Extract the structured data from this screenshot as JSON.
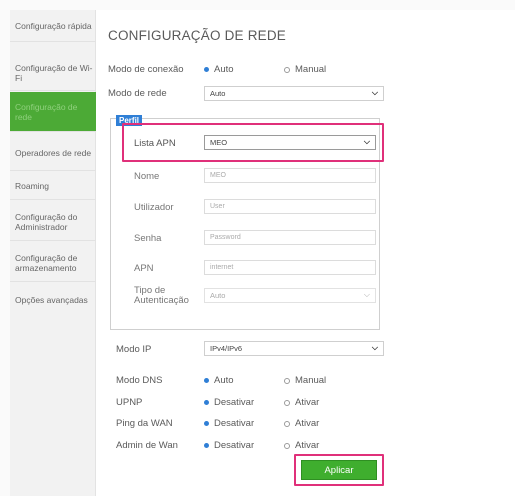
{
  "sidebar": {
    "items": [
      {
        "label": "Configuração rápida"
      },
      {
        "label": "Configuração de Wi-Fi"
      },
      {
        "label": "Configuração de rede"
      },
      {
        "label": "Operadores de rede"
      },
      {
        "label": "Roaming"
      },
      {
        "label": "Configuração do Administrador"
      },
      {
        "label": "Configuração de armazenamento"
      },
      {
        "label": "Opções avançadas"
      }
    ]
  },
  "page": {
    "title": "CONFIGURAÇÃO DE REDE"
  },
  "connection_mode": {
    "label": "Modo de conexão",
    "option_auto": "Auto",
    "option_manual": "Manual",
    "selected": "Auto"
  },
  "network_mode": {
    "label": "Modo de rede",
    "value": "Auto"
  },
  "profile": {
    "tag": "Perfil",
    "apn_list": {
      "label": "Lista APN",
      "value": "MEO"
    },
    "name": {
      "label": "Nome",
      "value": "MEO"
    },
    "user": {
      "label": "Utilizador",
      "placeholder": "User"
    },
    "password": {
      "label": "Senha",
      "placeholder": "Password"
    },
    "apn": {
      "label": "APN",
      "value": "internet"
    },
    "auth_type": {
      "label": "Tipo de Autenticação",
      "value": "Auto"
    }
  },
  "ip_mode": {
    "label": "Modo IP",
    "value": "IPv4/IPv6"
  },
  "dns_mode": {
    "label": "Modo DNS",
    "option_auto": "Auto",
    "option_manual": "Manual",
    "selected": "Auto"
  },
  "upnp": {
    "label": "UPNP",
    "option_off": "Desativar",
    "option_on": "Ativar",
    "selected": "Desativar"
  },
  "wan_ping": {
    "label": "Ping da WAN",
    "option_off": "Desativar",
    "option_on": "Ativar",
    "selected": "Desativar"
  },
  "wan_admin": {
    "label": "Admin de Wan",
    "option_off": "Desativar",
    "option_on": "Ativar",
    "selected": "Desativar"
  },
  "apply_button": {
    "label": "Aplicar"
  },
  "colors": {
    "accent_green": "#3fae2e",
    "highlight_pink": "#e0307a",
    "radio_blue": "#2f7fd6"
  }
}
